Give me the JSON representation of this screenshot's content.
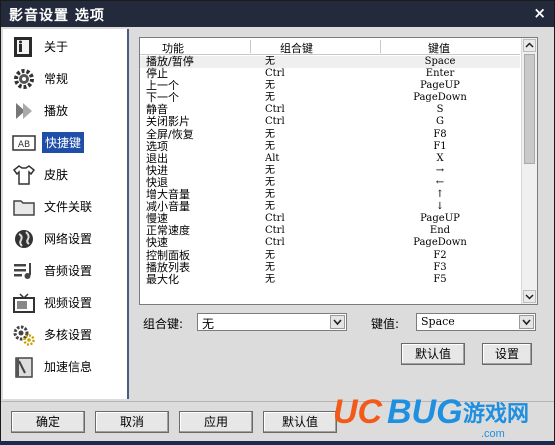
{
  "window": {
    "title": "影音设置 选项",
    "close_glyph": "×"
  },
  "sidebar": {
    "items": [
      {
        "label": "关于",
        "icon": "info-icon"
      },
      {
        "label": "常规",
        "icon": "gear-icon"
      },
      {
        "label": "播放",
        "icon": "play-icon"
      },
      {
        "label": "快捷键",
        "icon": "keyboard-icon",
        "active": true
      },
      {
        "label": "皮肤",
        "icon": "shirt-icon"
      },
      {
        "label": "文件关联",
        "icon": "folder-icon"
      },
      {
        "label": "网络设置",
        "icon": "globe-icon"
      },
      {
        "label": "音频设置",
        "icon": "audio-icon"
      },
      {
        "label": "视频设置",
        "icon": "tv-icon"
      },
      {
        "label": "多核设置",
        "icon": "cpu-icon"
      },
      {
        "label": "加速信息",
        "icon": "book-icon"
      }
    ]
  },
  "table": {
    "headers": [
      "功能",
      "组合键",
      "键值"
    ],
    "rows": [
      {
        "func": "播放/暂停",
        "mod": "无",
        "key": "Space",
        "selected": true
      },
      {
        "func": "停止",
        "mod": "Ctrl",
        "key": "Enter"
      },
      {
        "func": "上一个",
        "mod": "无",
        "key": "PageUP"
      },
      {
        "func": "下一个",
        "mod": "无",
        "key": "PageDown"
      },
      {
        "func": "静音",
        "mod": "Ctrl",
        "key": "S"
      },
      {
        "func": "关闭影片",
        "mod": "Ctrl",
        "key": "G"
      },
      {
        "func": "全屏/恢复",
        "mod": "无",
        "key": "F8"
      },
      {
        "func": "选项",
        "mod": "无",
        "key": "F1"
      },
      {
        "func": "退出",
        "mod": "Alt",
        "key": "X"
      },
      {
        "func": "快进",
        "mod": "无",
        "key": "→"
      },
      {
        "func": "快退",
        "mod": "无",
        "key": "←"
      },
      {
        "func": "增大音量",
        "mod": "无",
        "key": "↑"
      },
      {
        "func": "减小音量",
        "mod": "无",
        "key": "↓"
      },
      {
        "func": "慢速",
        "mod": "Ctrl",
        "key": "PageUP"
      },
      {
        "func": "正常速度",
        "mod": "Ctrl",
        "key": "End"
      },
      {
        "func": "快速",
        "mod": "Ctrl",
        "key": "PageDown"
      },
      {
        "func": "控制面板",
        "mod": "无",
        "key": "F2"
      },
      {
        "func": "播放列表",
        "mod": "无",
        "key": "F3"
      },
      {
        "func": "最大化",
        "mod": "无",
        "key": "F5"
      }
    ]
  },
  "editor": {
    "mod_label": "组合键:",
    "mod_value": "无",
    "key_label": "键值:",
    "key_value": "Space",
    "default_button": "默认值",
    "set_button": "设置"
  },
  "footer": {
    "ok": "确定",
    "cancel": "取消",
    "apply": "应用",
    "default": "默认值"
  },
  "watermark": {
    "brand": "UCBUG",
    "text": "游戏网",
    "domain": ".com"
  },
  "colors": {
    "titlebar": "#232a3c",
    "selection": "#1f4ea8",
    "sidebar_border": "#4d5a84",
    "watermark_orange": "#f25a1a",
    "watermark_blue": "#1f8fe0"
  }
}
